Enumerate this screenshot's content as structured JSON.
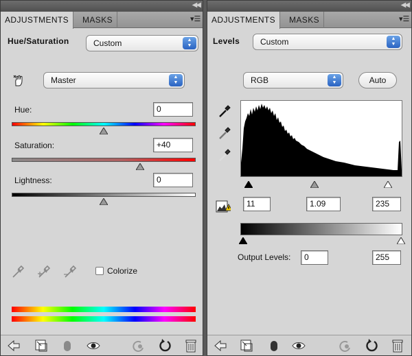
{
  "left_panel": {
    "tabs": [
      "ADJUSTMENTS",
      "MASKS"
    ],
    "title": "Hue/Saturation",
    "preset": "Custom",
    "channel": "Master",
    "hue_label": "Hue:",
    "hue_value": "0",
    "saturation_label": "Saturation:",
    "saturation_value": "+40",
    "lightness_label": "Lightness:",
    "lightness_value": "0",
    "colorize_label": "Colorize",
    "hue_slider_percent": 50,
    "saturation_slider_percent": 70,
    "lightness_slider_percent": 50
  },
  "right_panel": {
    "tabs": [
      "ADJUSTMENTS",
      "MASKS"
    ],
    "title": "Levels",
    "preset": "Custom",
    "channel": "RGB",
    "auto_label": "Auto",
    "input_black": "11",
    "input_gamma": "1.09",
    "input_white": "235",
    "output_label": "Output Levels:",
    "output_black": "0",
    "output_white": "255"
  },
  "icons": {
    "hand_tool": "targeted-adjustment-hand-icon",
    "eyedroppers": [
      "eyedropper-icon",
      "eyedropper-plus-icon",
      "eyedropper-minus-icon"
    ],
    "levels_eyedroppers": [
      "black-point-eyedropper-icon",
      "gray-point-eyedropper-icon",
      "white-point-eyedropper-icon"
    ],
    "clipping_warning": "clipping-warning-icon",
    "bottom": [
      "back-arrow-icon",
      "expand-view-icon",
      "clip-to-layer-icon",
      "visibility-eye-icon",
      "previous-state-icon",
      "reset-icon",
      "trash-icon"
    ]
  }
}
